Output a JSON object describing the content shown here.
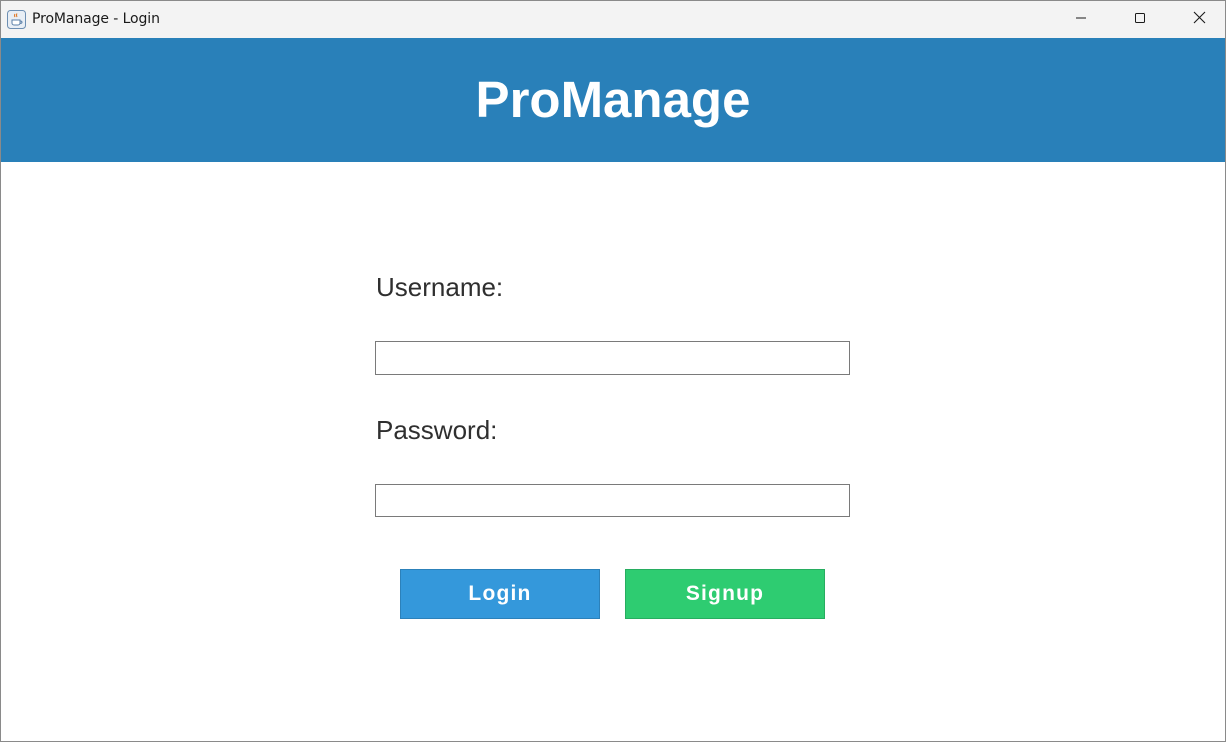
{
  "window": {
    "title": "ProManage - Login",
    "icons": {
      "app": "java-coffee-cup-icon",
      "minimize": "minimize-icon",
      "maximize": "maximize-icon",
      "close": "close-icon"
    }
  },
  "header": {
    "title": "ProManage",
    "background": "#2980b9"
  },
  "form": {
    "username_label": "Username:",
    "username_value": "",
    "password_label": "Password:",
    "password_value": ""
  },
  "buttons": {
    "login_label": "Login",
    "login_color": "#3498db",
    "signup_label": "Signup",
    "signup_color": "#2ecc71"
  }
}
